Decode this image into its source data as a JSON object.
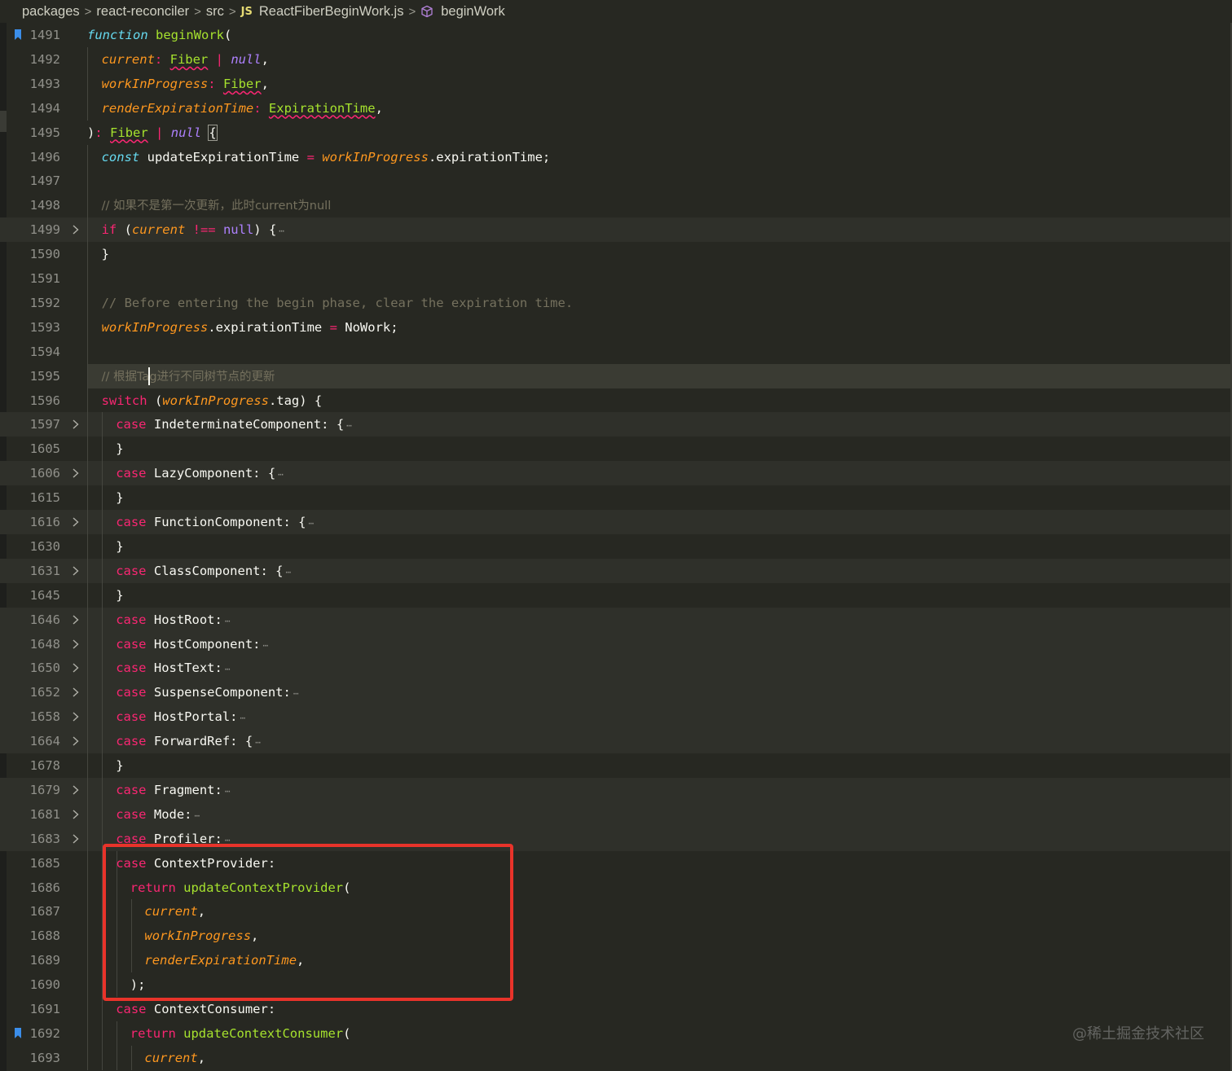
{
  "breadcrumb": {
    "items": [
      "packages",
      "react-reconciler",
      "src",
      "ReactFiberBeginWork.js",
      "beginWork"
    ],
    "file_badge": "JS",
    "separator": ">"
  },
  "editor": {
    "lines": [
      {
        "n": "1491",
        "bookmark": true
      },
      {
        "n": "1492"
      },
      {
        "n": "1493"
      },
      {
        "n": "1494"
      },
      {
        "n": "1495"
      },
      {
        "n": "1496"
      },
      {
        "n": "1497"
      },
      {
        "n": "1498"
      },
      {
        "n": "1499",
        "folded": true
      },
      {
        "n": "1590"
      },
      {
        "n": "1591"
      },
      {
        "n": "1592"
      },
      {
        "n": "1593"
      },
      {
        "n": "1594"
      },
      {
        "n": "1595",
        "current": true
      },
      {
        "n": "1596"
      },
      {
        "n": "1597",
        "folded": true
      },
      {
        "n": "1605"
      },
      {
        "n": "1606",
        "folded": true
      },
      {
        "n": "1615"
      },
      {
        "n": "1616",
        "folded": true
      },
      {
        "n": "1630"
      },
      {
        "n": "1631",
        "folded": true
      },
      {
        "n": "1645"
      },
      {
        "n": "1646",
        "folded": true
      },
      {
        "n": "1648",
        "folded": true
      },
      {
        "n": "1650",
        "folded": true
      },
      {
        "n": "1652",
        "folded": true
      },
      {
        "n": "1658",
        "folded": true
      },
      {
        "n": "1664",
        "folded": true
      },
      {
        "n": "1678"
      },
      {
        "n": "1679",
        "folded": true
      },
      {
        "n": "1681",
        "folded": true
      },
      {
        "n": "1683",
        "folded": true
      },
      {
        "n": "1685"
      },
      {
        "n": "1686"
      },
      {
        "n": "1687"
      },
      {
        "n": "1688"
      },
      {
        "n": "1689"
      },
      {
        "n": "1690"
      },
      {
        "n": "1691"
      },
      {
        "n": "1692",
        "bookmark": true
      },
      {
        "n": "1693"
      }
    ],
    "code": {
      "l1491_kw": "function",
      "l1491_fn": "beginWork",
      "l1491_p": "(",
      "l1492_param": "current",
      "l1492_colon": ":",
      "l1492_type": "Fiber",
      "l1492_pipe": "|",
      "l1492_null": "null",
      "l1492_comma": ",",
      "l1493_param": "workInProgress",
      "l1493_colon": ":",
      "l1493_type": "Fiber",
      "l1493_comma": ",",
      "l1494_param": "renderExpirationTime",
      "l1494_colon": ":",
      "l1494_type": "ExpirationTime",
      "l1494_comma": ",",
      "l1495_close": ")",
      "l1495_colon": ":",
      "l1495_type": "Fiber",
      "l1495_pipe": "|",
      "l1495_null": "null",
      "l1495_brace": "{",
      "l1496_kw": "const",
      "l1496_name": "updateExpirationTime",
      "l1496_eq": "=",
      "l1496_obj": "workInProgress",
      "l1496_prop": ".expirationTime;",
      "l1498_cmt": "// 如果不是第一次更新，此时current为null",
      "l1499_kw": "if",
      "l1499_open": "(",
      "l1499_param": "current",
      "l1499_op": "!==",
      "l1499_null": "null",
      "l1499_rest": ") {",
      "l1590_brace": "}",
      "l1592_cmt": "// Before entering the begin phase, clear the expiration time.",
      "l1593_obj": "workInProgress",
      "l1593_prop": ".expirationTime",
      "l1593_eq": "=",
      "l1593_val": "NoWork;",
      "l1595_cmt_a": "// 根据Ta",
      "l1595_cmt_b": "g进行不同树节点的更新",
      "l1596_kw": "switch",
      "l1596_open": "(",
      "l1596_obj": "workInProgress",
      "l1596_rest": ".tag) {",
      "case_kw": "case",
      "l1597_name": "IndeterminateComponent: {",
      "l1606_name": "LazyComponent: {",
      "l1616_name": "FunctionComponent: {",
      "l1631_name": "ClassComponent: {",
      "l1646_name": "HostRoot:",
      "l1648_name": "HostComponent:",
      "l1650_name": "HostText:",
      "l1652_name": "SuspenseComponent:",
      "l1658_name": "HostPortal:",
      "l1664_name": "ForwardRef: {",
      "l1679_name": "Fragment:",
      "l1681_name": "Mode:",
      "l1683_name": "Profiler:",
      "l1685_name": "ContextProvider:",
      "return_kw": "return",
      "l1686_fn": "updateContextProvider",
      "l1686_p": "(",
      "l1687_param": "current",
      "l1687_comma": ",",
      "l1688_param": "workInProgress",
      "l1688_comma": ",",
      "l1689_param": "renderExpirationTime",
      "l1689_comma": ",",
      "l1690_close": ");",
      "l1691_name": "ContextConsumer:",
      "l1692_fn": "updateContextConsumer",
      "l1692_p": "(",
      "l1693_param": "current",
      "l1693_comma": ",",
      "close_brace": "}",
      "ellipsis": "⋯"
    }
  },
  "watermark": "@稀土掘金技术社区",
  "colors": {
    "background": "#272822",
    "keyword": "#f92672",
    "function": "#a6e22e",
    "parameter": "#fd971f",
    "storage": "#66d9ef",
    "constant": "#ae81ff",
    "comment": "#75715e",
    "annotation_box": "#e8332a",
    "bookmark": "#3b8eea"
  }
}
